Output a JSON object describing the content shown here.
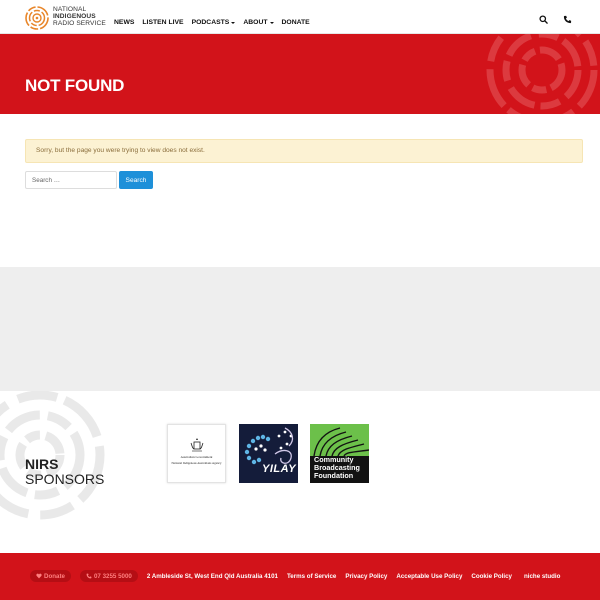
{
  "header": {
    "logo_line1": "National",
    "logo_line2": "Indigenous",
    "logo_line3": "Radio Service",
    "nav": {
      "news": "NEWS",
      "listen_live": "LISTEN LIVE",
      "podcasts": "PODCASTS",
      "about": "ABOUT",
      "donate": "DONATE"
    },
    "icons": [
      "search-icon",
      "phone-icon"
    ]
  },
  "hero": {
    "title": "NOT FOUND"
  },
  "main": {
    "alert_text": "Sorry, but the page you were trying to view does not exist.",
    "search_placeholder": "Search …",
    "search_button": "Search"
  },
  "sponsors": {
    "title_bold": "NIRS",
    "title_light": "SPONSORS",
    "gov_line1": "Australian Government",
    "gov_line2": "National Indigenous Australians Agency",
    "yilay_label": "YILAY",
    "cbf_label_1": "Community",
    "cbf_label_2": "Broadcasting",
    "cbf_label_3": "Foundation"
  },
  "footer": {
    "donate_pill": "Donate",
    "phone_pill": "07 3255 5000",
    "address": "2 Ambleside St, West End Qld Australia 4101",
    "terms": "Terms of Service",
    "privacy": "Privacy Policy",
    "acceptable_use": "Acceptable Use Policy",
    "cookie": "Cookie Policy",
    "credit": "niche studio"
  },
  "colors": {
    "brand_red": "#d2131a",
    "logo_orange": "#e8862a",
    "search_blue": "#1e90d9",
    "alert_bg": "#fcf2d3"
  }
}
